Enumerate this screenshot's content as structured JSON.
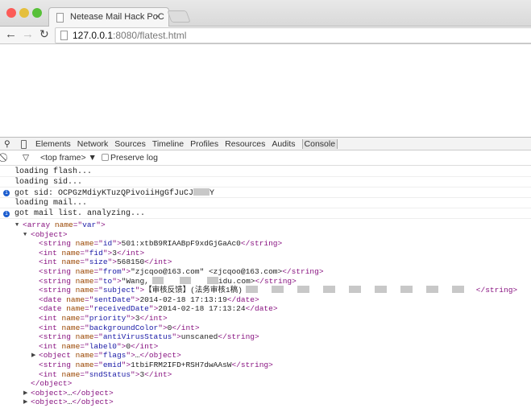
{
  "browser": {
    "tab_title": "Netease Mail Hack PoC",
    "tab_close": "×",
    "url_host": "127.0.0.1",
    "url_rest": ":8080/flatest.html",
    "colors": {
      "close": "#fc5b57",
      "min": "#e5bf3c",
      "max": "#57c038"
    }
  },
  "devtools": {
    "tabs": [
      "Elements",
      "Network",
      "Sources",
      "Timeline",
      "Profiles",
      "Resources",
      "Audits",
      "Console"
    ],
    "active": "Console",
    "frame": "<top frame>",
    "preserve_log": "Preserve log"
  },
  "console": [
    {
      "text": "loading flash...",
      "info": false
    },
    {
      "text": "loading sid...",
      "info": false
    },
    {
      "text": "got sid: OCPGzMdiyKTuzQPivoiiHgGfJuCJ",
      "info": true,
      "redacted": true,
      "suffix": "Y"
    },
    {
      "text": "loading mail...",
      "info": false
    },
    {
      "text": "got mail list. analyzing...",
      "info": true
    }
  ],
  "xml": [
    {
      "lvl": 0,
      "tog": "open",
      "tag": "array",
      "an": "name",
      "av": "var"
    },
    {
      "lvl": 1,
      "tog": "open",
      "tag": "object"
    },
    {
      "lvl": 2,
      "tag": "string",
      "an": "name",
      "av": "id",
      "text": "501:xtbB9RIAABpF9xdGjGaAc0",
      "close": "string"
    },
    {
      "lvl": 2,
      "tag": "int",
      "an": "name",
      "av": "fid",
      "text": "3",
      "close": "int"
    },
    {
      "lvl": 2,
      "tag": "int",
      "an": "name",
      "av": "size",
      "text": "568150",
      "close": "int"
    },
    {
      "lvl": 2,
      "tag": "string",
      "an": "name",
      "av": "from",
      "text": "\"zjcqoo@163.com\" <zjcqoo@163.com>",
      "close": "string"
    },
    {
      "lvl": 2,
      "tag": "string",
      "an": "name",
      "av": "to",
      "text": "\"Wang,",
      "redact": 3,
      "text2": "idu.com>",
      "close": "string"
    },
    {
      "lvl": 2,
      "tag": "string",
      "an": "name",
      "av": "subject",
      "text": "【审核反馈】(法务审核1稿)",
      "redact": 9,
      "close": "string"
    },
    {
      "lvl": 2,
      "tag": "date",
      "an": "name",
      "av": "sentDate",
      "text": "2014-02-18 17:13:19",
      "close": "date"
    },
    {
      "lvl": 2,
      "tag": "date",
      "an": "name",
      "av": "receivedDate",
      "text": "2014-02-18 17:13:24",
      "close": "date"
    },
    {
      "lvl": 2,
      "tag": "int",
      "an": "name",
      "av": "priority",
      "text": "3",
      "close": "int"
    },
    {
      "lvl": 2,
      "tag": "int",
      "an": "name",
      "av": "backgroundColor",
      "text": "0",
      "close": "int"
    },
    {
      "lvl": 2,
      "tag": "string",
      "an": "name",
      "av": "antiVirusStatus",
      "text": "unscaned",
      "close": "string"
    },
    {
      "lvl": 2,
      "tag": "int",
      "an": "name",
      "av": "label0",
      "text": "0",
      "close": "int"
    },
    {
      "lvl": 2,
      "tog": "closed",
      "tag": "object",
      "an": "name",
      "av": "flags",
      "text": "…",
      "close": "object"
    },
    {
      "lvl": 2,
      "tag": "string",
      "an": "name",
      "av": "emid",
      "text": "1tbiFRM2IFD+RSH7dwAAsW",
      "close": "string"
    },
    {
      "lvl": 2,
      "tag": "int",
      "an": "name",
      "av": "sndStatus",
      "text": "3",
      "close": "int"
    },
    {
      "lvl": 1,
      "endtag": "object"
    },
    {
      "lvl": 1,
      "tog": "closed",
      "tag": "object",
      "text": "…",
      "close": "object"
    },
    {
      "lvl": 1,
      "tog": "closed",
      "tag": "object",
      "text": "…",
      "close": "object"
    }
  ]
}
